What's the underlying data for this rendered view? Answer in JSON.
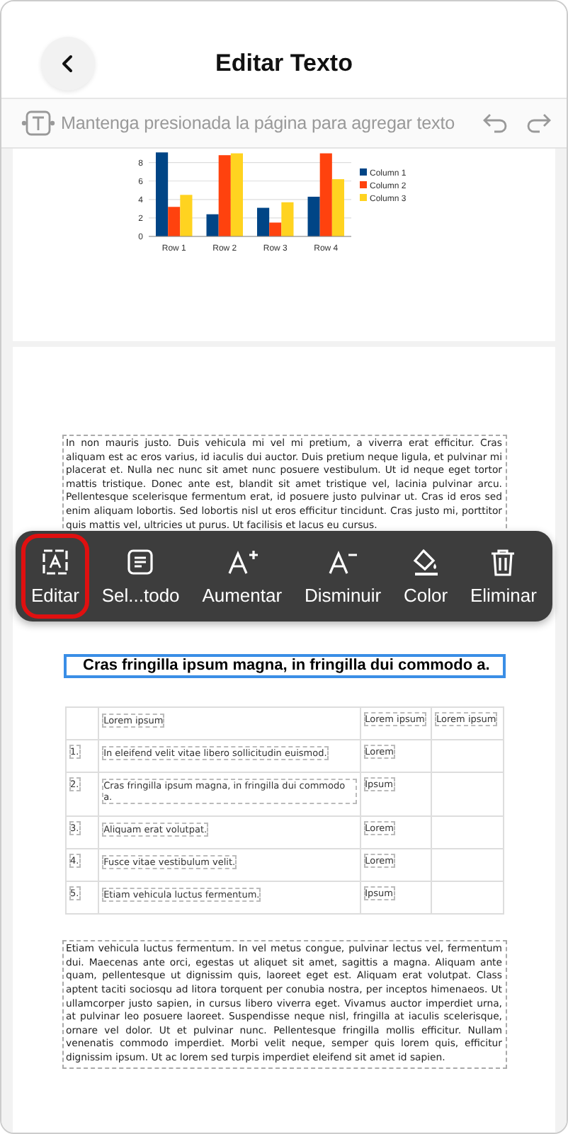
{
  "header": {
    "title": "Editar Texto"
  },
  "hint_bar": {
    "placeholder": "Mantenga presionada la página para agregar texto"
  },
  "chart": {
    "chart_data": {
      "type": "bar",
      "categories": [
        "Row 1",
        "Row 2",
        "Row 3",
        "Row 4"
      ],
      "ylim": [
        0,
        9.2
      ],
      "yticks": [
        0,
        2,
        4,
        6,
        8
      ],
      "grid": true,
      "legend": "right",
      "series": [
        {
          "name": "Column 1",
          "color": "#004586",
          "values": [
            9.1,
            2.4,
            3.1,
            4.3
          ]
        },
        {
          "name": "Column 2",
          "color": "#ff420e",
          "values": [
            3.2,
            8.8,
            1.5,
            9.0
          ]
        },
        {
          "name": "Column 3",
          "color": "#ffd320",
          "values": [
            4.5,
            9.0,
            3.7,
            6.2
          ]
        }
      ]
    }
  },
  "paragraph_1": "In non mauris justo. Duis vehicula mi vel mi pretium, a viverra erat efficitur. Cras aliquam est ac eros varius, id iaculis dui auctor. Duis pretium neque ligula, et pulvinar mi placerat et. Nulla nec nunc sit amet nunc posuere vestibulum. Ut id neque eget tortor mattis tristique. Donec ante est, blandit sit amet tristique vel, lacinia pulvinar arcu. Pellentesque scelerisque fermentum erat, id posuere justo pulvinar ut. Cras id eros sed enim aliquam lobortis. Sed lobortis nisl ut eros efficitur tincidunt. Cras justo mi, porttitor quis mattis vel, ultricies ut purus. Ut facilisis et lacus eu cursus.",
  "toolbar": [
    {
      "label": "Editar",
      "selected": true
    },
    {
      "label": "Sel...todo",
      "selected": false
    },
    {
      "label": "Aumentar",
      "selected": false
    },
    {
      "label": "Disminuir",
      "selected": false
    },
    {
      "label": "Color",
      "selected": false
    },
    {
      "label": "Eliminar",
      "selected": false
    }
  ],
  "heading": "Cras fringilla ipsum magna, in fringilla dui commodo a.",
  "table": {
    "columns": [
      "Lorem ipsum",
      "Lorem ipsum",
      "Lorem ipsum"
    ],
    "rows": [
      {
        "number": "1.",
        "text": "In eleifend velit vitae libero sollicitudin euismod.",
        "value": "Lorem"
      },
      {
        "number": "2.",
        "text": "Cras fringilla ipsum magna, in fringilla dui commodo a.",
        "value": "Ipsum"
      },
      {
        "number": "3.",
        "text": "Aliquam erat volutpat.",
        "value": "Lorem"
      },
      {
        "number": "4.",
        "text": "Fusce vitae vestibulum velit.",
        "value": "Lorem"
      },
      {
        "number": "5.",
        "text": "Etiam vehicula luctus fermentum.",
        "value": "Ipsum"
      }
    ]
  },
  "paragraph_2": "Etiam vehicula luctus fermentum. In vel metus congue, pulvinar lectus vel, fermentum dui. Maecenas ante orci, egestas ut aliquet sit amet, sagittis a magna. Aliquam ante quam, pellentesque ut dignissim quis, laoreet eget est. Aliquam erat volutpat. Class aptent taciti sociosqu ad litora torquent per conubia nostra, per inceptos himenaeos. Ut ullamcorper justo sapien, in cursus libero viverra eget. Vivamus auctor imperdiet urna, at pulvinar leo posuere laoreet. Suspendisse neque nisl, fringilla at iaculis scelerisque, ornare vel dolor. Ut et pulvinar nunc. Pellentesque fringilla mollis efficitur. Nullam venenatis commodo imperdiet. Morbi velit neque, semper quis lorem quis, efficitur dignissim ipsum. Ut ac lorem sed turpis imperdiet eleifend sit amet id sapien."
}
